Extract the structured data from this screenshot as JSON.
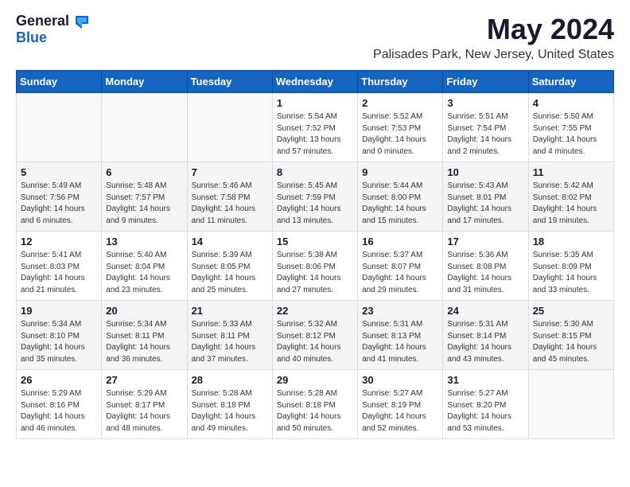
{
  "header": {
    "logo_general": "General",
    "logo_blue": "Blue",
    "month_year": "May 2024",
    "location": "Palisades Park, New Jersey, United States"
  },
  "weekdays": [
    "Sunday",
    "Monday",
    "Tuesday",
    "Wednesday",
    "Thursday",
    "Friday",
    "Saturday"
  ],
  "weeks": [
    [
      {
        "day": "",
        "info": ""
      },
      {
        "day": "",
        "info": ""
      },
      {
        "day": "",
        "info": ""
      },
      {
        "day": "1",
        "info": "Sunrise: 5:54 AM\nSunset: 7:52 PM\nDaylight: 13 hours\nand 57 minutes."
      },
      {
        "day": "2",
        "info": "Sunrise: 5:52 AM\nSunset: 7:53 PM\nDaylight: 14 hours\nand 0 minutes."
      },
      {
        "day": "3",
        "info": "Sunrise: 5:51 AM\nSunset: 7:54 PM\nDaylight: 14 hours\nand 2 minutes."
      },
      {
        "day": "4",
        "info": "Sunrise: 5:50 AM\nSunset: 7:55 PM\nDaylight: 14 hours\nand 4 minutes."
      }
    ],
    [
      {
        "day": "5",
        "info": "Sunrise: 5:49 AM\nSunset: 7:56 PM\nDaylight: 14 hours\nand 6 minutes."
      },
      {
        "day": "6",
        "info": "Sunrise: 5:48 AM\nSunset: 7:57 PM\nDaylight: 14 hours\nand 9 minutes."
      },
      {
        "day": "7",
        "info": "Sunrise: 5:46 AM\nSunset: 7:58 PM\nDaylight: 14 hours\nand 11 minutes."
      },
      {
        "day": "8",
        "info": "Sunrise: 5:45 AM\nSunset: 7:59 PM\nDaylight: 14 hours\nand 13 minutes."
      },
      {
        "day": "9",
        "info": "Sunrise: 5:44 AM\nSunset: 8:00 PM\nDaylight: 14 hours\nand 15 minutes."
      },
      {
        "day": "10",
        "info": "Sunrise: 5:43 AM\nSunset: 8:01 PM\nDaylight: 14 hours\nand 17 minutes."
      },
      {
        "day": "11",
        "info": "Sunrise: 5:42 AM\nSunset: 8:02 PM\nDaylight: 14 hours\nand 19 minutes."
      }
    ],
    [
      {
        "day": "12",
        "info": "Sunrise: 5:41 AM\nSunset: 8:03 PM\nDaylight: 14 hours\nand 21 minutes."
      },
      {
        "day": "13",
        "info": "Sunrise: 5:40 AM\nSunset: 8:04 PM\nDaylight: 14 hours\nand 23 minutes."
      },
      {
        "day": "14",
        "info": "Sunrise: 5:39 AM\nSunset: 8:05 PM\nDaylight: 14 hours\nand 25 minutes."
      },
      {
        "day": "15",
        "info": "Sunrise: 5:38 AM\nSunset: 8:06 PM\nDaylight: 14 hours\nand 27 minutes."
      },
      {
        "day": "16",
        "info": "Sunrise: 5:37 AM\nSunset: 8:07 PM\nDaylight: 14 hours\nand 29 minutes."
      },
      {
        "day": "17",
        "info": "Sunrise: 5:36 AM\nSunset: 8:08 PM\nDaylight: 14 hours\nand 31 minutes."
      },
      {
        "day": "18",
        "info": "Sunrise: 5:35 AM\nSunset: 8:09 PM\nDaylight: 14 hours\nand 33 minutes."
      }
    ],
    [
      {
        "day": "19",
        "info": "Sunrise: 5:34 AM\nSunset: 8:10 PM\nDaylight: 14 hours\nand 35 minutes."
      },
      {
        "day": "20",
        "info": "Sunrise: 5:34 AM\nSunset: 8:11 PM\nDaylight: 14 hours\nand 36 minutes."
      },
      {
        "day": "21",
        "info": "Sunrise: 5:33 AM\nSunset: 8:11 PM\nDaylight: 14 hours\nand 37 minutes."
      },
      {
        "day": "22",
        "info": "Sunrise: 5:32 AM\nSunset: 8:12 PM\nDaylight: 14 hours\nand 40 minutes."
      },
      {
        "day": "23",
        "info": "Sunrise: 5:31 AM\nSunset: 8:13 PM\nDaylight: 14 hours\nand 41 minutes."
      },
      {
        "day": "24",
        "info": "Sunrise: 5:31 AM\nSunset: 8:14 PM\nDaylight: 14 hours\nand 43 minutes."
      },
      {
        "day": "25",
        "info": "Sunrise: 5:30 AM\nSunset: 8:15 PM\nDaylight: 14 hours\nand 45 minutes."
      }
    ],
    [
      {
        "day": "26",
        "info": "Sunrise: 5:29 AM\nSunset: 8:16 PM\nDaylight: 14 hours\nand 46 minutes."
      },
      {
        "day": "27",
        "info": "Sunrise: 5:29 AM\nSunset: 8:17 PM\nDaylight: 14 hours\nand 48 minutes."
      },
      {
        "day": "28",
        "info": "Sunrise: 5:28 AM\nSunset: 8:18 PM\nDaylight: 14 hours\nand 49 minutes."
      },
      {
        "day": "29",
        "info": "Sunrise: 5:28 AM\nSunset: 8:18 PM\nDaylight: 14 hours\nand 50 minutes."
      },
      {
        "day": "30",
        "info": "Sunrise: 5:27 AM\nSunset: 8:19 PM\nDaylight: 14 hours\nand 52 minutes."
      },
      {
        "day": "31",
        "info": "Sunrise: 5:27 AM\nSunset: 8:20 PM\nDaylight: 14 hours\nand 53 minutes."
      },
      {
        "day": "",
        "info": ""
      }
    ]
  ]
}
